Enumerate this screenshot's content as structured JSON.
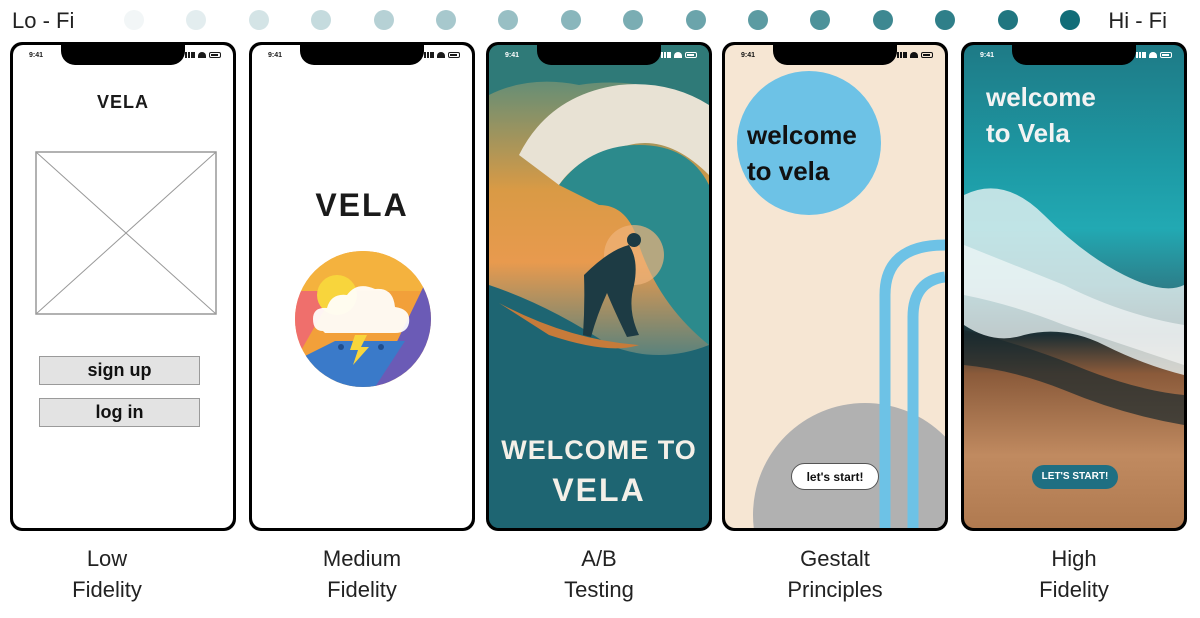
{
  "scale": {
    "left_label": "Lo - Fi",
    "right_label": "Hi - Fi",
    "dot_count": 16,
    "start_color": "#f2f6f7",
    "end_color": "#116d78"
  },
  "phones": [
    {
      "status_time": "9:41",
      "title": "VELA",
      "buttons": [
        "sign up",
        "log in"
      ],
      "caption_line1": "Low",
      "caption_line2": "Fidelity"
    },
    {
      "status_time": "9:41",
      "title": "VELA",
      "icon": "weather-storm-icon",
      "caption_line1": "Medium",
      "caption_line2": "Fidelity"
    },
    {
      "status_time": "9:41",
      "headline_line1": "WELCOME TO",
      "headline_line2": "VELA",
      "caption_line1": "A/B",
      "caption_line2": "Testing"
    },
    {
      "status_time": "9:41",
      "headline_line1": "welcome",
      "headline_line2": "to vela",
      "button": "let's start!",
      "accent": "#6dc2e6",
      "caption_line1": "Gestalt",
      "caption_line2": "Principles"
    },
    {
      "status_time": "9:41",
      "headline_line1": "welcome",
      "headline_line2": "to Vela",
      "button": "LET'S START!",
      "caption_line1": "High",
      "caption_line2": "Fidelity"
    }
  ]
}
